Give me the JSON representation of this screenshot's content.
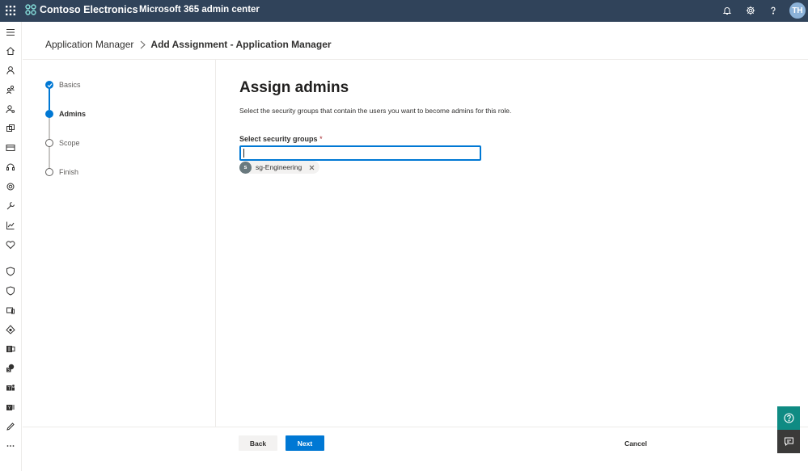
{
  "topbar": {
    "brand": "Contoso Electronics",
    "app": "Microsoft 365 admin center",
    "avatar_initials": "TH",
    "colors": {
      "background": "#30435a",
      "avatar": "#8cb2d8"
    },
    "icons": [
      "waffle-icon",
      "contoso-logo-icon",
      "bell-icon",
      "gear-icon",
      "help-icon"
    ]
  },
  "nav_rail": {
    "icons": [
      "collapse-menu-icon",
      "home-icon",
      "users-icon",
      "groups-icon",
      "roles-icon",
      "resources-icon",
      "billing-icon",
      "support-icon",
      "settings-icon",
      "setup-icon",
      "reports-icon",
      "health-icon",
      "security-icon",
      "compliance-icon",
      "endpoint-manager-icon",
      "azure-ad-icon",
      "exchange-icon",
      "sharepoint-icon",
      "teams-icon",
      "yammer-icon",
      "customize-icon",
      "more-icon"
    ]
  },
  "breadcrumb": {
    "parent": "Application Manager",
    "current": "Add Assignment - Application Manager"
  },
  "steps": [
    {
      "label": "Basics",
      "state": "done"
    },
    {
      "label": "Admins",
      "state": "current"
    },
    {
      "label": "Scope",
      "state": "todo"
    },
    {
      "label": "Finish",
      "state": "todo"
    }
  ],
  "main": {
    "title": "Assign admins",
    "description": "Select the security groups that contain the users you want to become admins for this role.",
    "field_label": "Select security groups",
    "required_marker": "*",
    "input_value": "",
    "selected_group": {
      "initial": "s",
      "name": "sg-Engineering"
    }
  },
  "footer": {
    "back": "Back",
    "next": "Next",
    "cancel": "Cancel"
  },
  "floating": {
    "help_icon": "help-circle-icon",
    "feedback_icon": "feedback-icon",
    "colors": {
      "help": "#0f8b83",
      "feedback": "#3b3a39"
    }
  },
  "accent_color": "#0078d4"
}
